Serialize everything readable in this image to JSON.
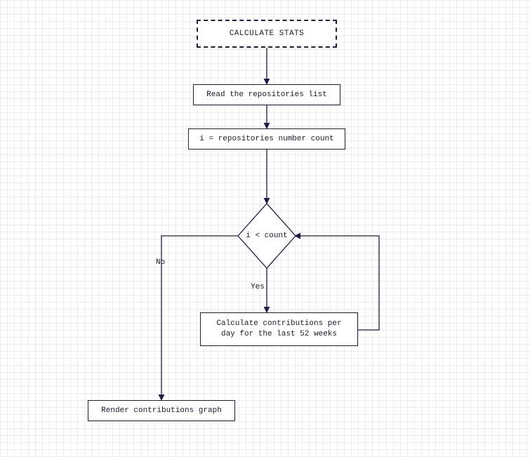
{
  "title": "CALCULATE STATS",
  "steps": {
    "read_list": "Read the repositories list",
    "init_counter": "i = repositories number count",
    "condition": "i < count",
    "calc": "Calculate contributions per\nday for the last 52 weeks",
    "render": "Render contributions graph"
  },
  "labels": {
    "yes": "Yes",
    "no": "No"
  }
}
